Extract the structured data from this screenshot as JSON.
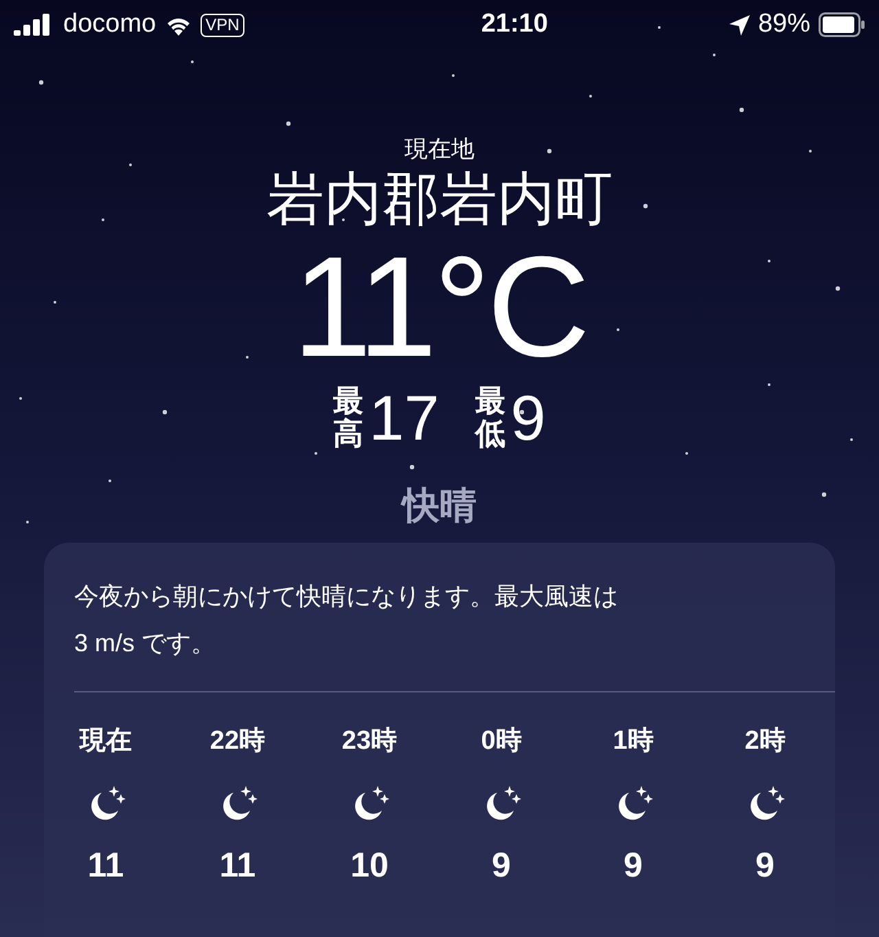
{
  "status_bar": {
    "carrier": "docomo",
    "vpn": "VPN",
    "time": "21:10",
    "battery": "89%"
  },
  "header": {
    "location_label": "現在地",
    "city": "岩内郡岩内町",
    "temperature": "11°C",
    "high": {
      "label": "最高",
      "value": "17"
    },
    "low": {
      "label": "最低",
      "value": "9"
    },
    "condition": "快晴"
  },
  "forecast_card": {
    "summary": "今夜から朝にかけて快晴になります。最大風速は\n3 m/s です。",
    "hours": [
      {
        "time": "現在",
        "temp": "11"
      },
      {
        "time": "22時",
        "temp": "11"
      },
      {
        "time": "23時",
        "temp": "10"
      },
      {
        "time": "0時",
        "temp": "9"
      },
      {
        "time": "1時",
        "temp": "9"
      },
      {
        "time": "2時",
        "temp": "9"
      }
    ]
  }
}
